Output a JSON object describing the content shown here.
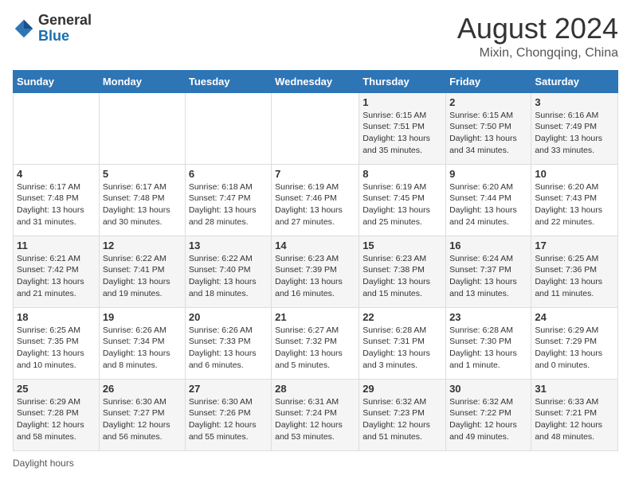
{
  "header": {
    "logo_general": "General",
    "logo_blue": "Blue",
    "month_year": "August 2024",
    "location": "Mixin, Chongqing, China"
  },
  "weekdays": [
    "Sunday",
    "Monday",
    "Tuesday",
    "Wednesday",
    "Thursday",
    "Friday",
    "Saturday"
  ],
  "weeks": [
    [
      {
        "day": "",
        "info": ""
      },
      {
        "day": "",
        "info": ""
      },
      {
        "day": "",
        "info": ""
      },
      {
        "day": "",
        "info": ""
      },
      {
        "day": "1",
        "info": "Sunrise: 6:15 AM\nSunset: 7:51 PM\nDaylight: 13 hours and 35 minutes."
      },
      {
        "day": "2",
        "info": "Sunrise: 6:15 AM\nSunset: 7:50 PM\nDaylight: 13 hours and 34 minutes."
      },
      {
        "day": "3",
        "info": "Sunrise: 6:16 AM\nSunset: 7:49 PM\nDaylight: 13 hours and 33 minutes."
      }
    ],
    [
      {
        "day": "4",
        "info": "Sunrise: 6:17 AM\nSunset: 7:48 PM\nDaylight: 13 hours and 31 minutes."
      },
      {
        "day": "5",
        "info": "Sunrise: 6:17 AM\nSunset: 7:48 PM\nDaylight: 13 hours and 30 minutes."
      },
      {
        "day": "6",
        "info": "Sunrise: 6:18 AM\nSunset: 7:47 PM\nDaylight: 13 hours and 28 minutes."
      },
      {
        "day": "7",
        "info": "Sunrise: 6:19 AM\nSunset: 7:46 PM\nDaylight: 13 hours and 27 minutes."
      },
      {
        "day": "8",
        "info": "Sunrise: 6:19 AM\nSunset: 7:45 PM\nDaylight: 13 hours and 25 minutes."
      },
      {
        "day": "9",
        "info": "Sunrise: 6:20 AM\nSunset: 7:44 PM\nDaylight: 13 hours and 24 minutes."
      },
      {
        "day": "10",
        "info": "Sunrise: 6:20 AM\nSunset: 7:43 PM\nDaylight: 13 hours and 22 minutes."
      }
    ],
    [
      {
        "day": "11",
        "info": "Sunrise: 6:21 AM\nSunset: 7:42 PM\nDaylight: 13 hours and 21 minutes."
      },
      {
        "day": "12",
        "info": "Sunrise: 6:22 AM\nSunset: 7:41 PM\nDaylight: 13 hours and 19 minutes."
      },
      {
        "day": "13",
        "info": "Sunrise: 6:22 AM\nSunset: 7:40 PM\nDaylight: 13 hours and 18 minutes."
      },
      {
        "day": "14",
        "info": "Sunrise: 6:23 AM\nSunset: 7:39 PM\nDaylight: 13 hours and 16 minutes."
      },
      {
        "day": "15",
        "info": "Sunrise: 6:23 AM\nSunset: 7:38 PM\nDaylight: 13 hours and 15 minutes."
      },
      {
        "day": "16",
        "info": "Sunrise: 6:24 AM\nSunset: 7:37 PM\nDaylight: 13 hours and 13 minutes."
      },
      {
        "day": "17",
        "info": "Sunrise: 6:25 AM\nSunset: 7:36 PM\nDaylight: 13 hours and 11 minutes."
      }
    ],
    [
      {
        "day": "18",
        "info": "Sunrise: 6:25 AM\nSunset: 7:35 PM\nDaylight: 13 hours and 10 minutes."
      },
      {
        "day": "19",
        "info": "Sunrise: 6:26 AM\nSunset: 7:34 PM\nDaylight: 13 hours and 8 minutes."
      },
      {
        "day": "20",
        "info": "Sunrise: 6:26 AM\nSunset: 7:33 PM\nDaylight: 13 hours and 6 minutes."
      },
      {
        "day": "21",
        "info": "Sunrise: 6:27 AM\nSunset: 7:32 PM\nDaylight: 13 hours and 5 minutes."
      },
      {
        "day": "22",
        "info": "Sunrise: 6:28 AM\nSunset: 7:31 PM\nDaylight: 13 hours and 3 minutes."
      },
      {
        "day": "23",
        "info": "Sunrise: 6:28 AM\nSunset: 7:30 PM\nDaylight: 13 hours and 1 minute."
      },
      {
        "day": "24",
        "info": "Sunrise: 6:29 AM\nSunset: 7:29 PM\nDaylight: 13 hours and 0 minutes."
      }
    ],
    [
      {
        "day": "25",
        "info": "Sunrise: 6:29 AM\nSunset: 7:28 PM\nDaylight: 12 hours and 58 minutes."
      },
      {
        "day": "26",
        "info": "Sunrise: 6:30 AM\nSunset: 7:27 PM\nDaylight: 12 hours and 56 minutes."
      },
      {
        "day": "27",
        "info": "Sunrise: 6:30 AM\nSunset: 7:26 PM\nDaylight: 12 hours and 55 minutes."
      },
      {
        "day": "28",
        "info": "Sunrise: 6:31 AM\nSunset: 7:24 PM\nDaylight: 12 hours and 53 minutes."
      },
      {
        "day": "29",
        "info": "Sunrise: 6:32 AM\nSunset: 7:23 PM\nDaylight: 12 hours and 51 minutes."
      },
      {
        "day": "30",
        "info": "Sunrise: 6:32 AM\nSunset: 7:22 PM\nDaylight: 12 hours and 49 minutes."
      },
      {
        "day": "31",
        "info": "Sunrise: 6:33 AM\nSunset: 7:21 PM\nDaylight: 12 hours and 48 minutes."
      }
    ]
  ],
  "legend": {
    "daylight_label": "Daylight hours"
  }
}
